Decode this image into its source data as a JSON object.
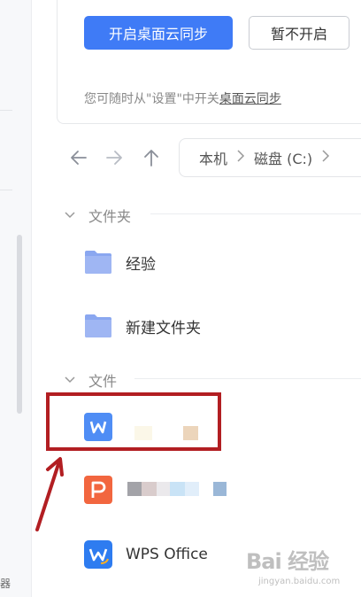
{
  "sync": {
    "enable_button": "开启桌面云同步",
    "skip_button": "暂不开启",
    "hint_prefix": "您可随时从\"设置\"中开关",
    "hint_link": "桌面云同步"
  },
  "nav": {
    "back_icon": "arrow-left-icon",
    "forward_icon": "arrow-right-icon",
    "up_icon": "arrow-up-icon",
    "breadcrumb": [
      "本机",
      "磁盘 (C:)"
    ]
  },
  "folders": {
    "header": "文件夹",
    "items": [
      {
        "name": "经验",
        "icon": "folder-icon"
      },
      {
        "name": "新建文件夹",
        "icon": "folder-icon"
      }
    ]
  },
  "files": {
    "header": "文件",
    "items": [
      {
        "name": "",
        "icon": "wps-writer-icon"
      },
      {
        "name": "",
        "icon": "wps-presentation-icon"
      },
      {
        "name": "WPS Office",
        "icon": "wps-office-icon"
      }
    ]
  },
  "colors": {
    "primary": "#3f7bf6",
    "folder": "#8aa7f0",
    "highlight": "#b21e22",
    "writer": "#4f8df5",
    "presentation": "#f2663f"
  },
  "watermark": {
    "main": "Bai 经验",
    "sub": "jingyan.baidu.com"
  },
  "sidebar": {
    "glyph": "器"
  }
}
